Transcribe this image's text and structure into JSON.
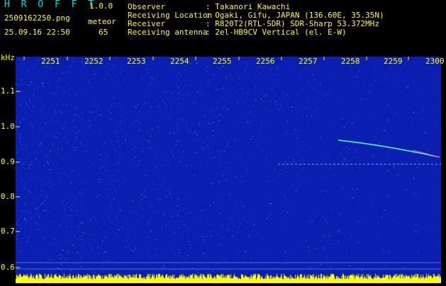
{
  "header": {
    "app_name": "H R O F F T",
    "version": "1.0.0",
    "filename": "2509162250.png",
    "meteor_label": "meteor",
    "datetime": "25.09.16 22:50",
    "meteor_count": "65",
    "info": [
      {
        "key": "Observer",
        "value": ": Takanori Kawachi"
      },
      {
        "key": "Receiving Location",
        "value": ": Ogaki, Gifu, JAPAN (136.60E, 35.35N)"
      },
      {
        "key": "Receiver",
        "value": ": R820T2(RTL-SDR) SDR-Sharp 53.372MHz"
      },
      {
        "key": "Receiving antenna",
        "value": ": 2el-HB9CV Vertical (el. E-W)"
      }
    ]
  },
  "spectrogram": {
    "y_unit": "kHz",
    "y_ticks": [
      "1.1",
      "1.0",
      "0.9",
      "0.8",
      "0.7",
      "0.6"
    ],
    "x_ticks": [
      "2251",
      "2252",
      "2253",
      "2254",
      "2255",
      "2256",
      "2257",
      "2258",
      "2259",
      "2300"
    ],
    "colors": {
      "background": "#0a1fb0",
      "noise_hi": "#00c8ff",
      "noise_mid": "#1e50ff",
      "trace": "#40ffd0",
      "baseline": "#ffff00"
    }
  }
}
